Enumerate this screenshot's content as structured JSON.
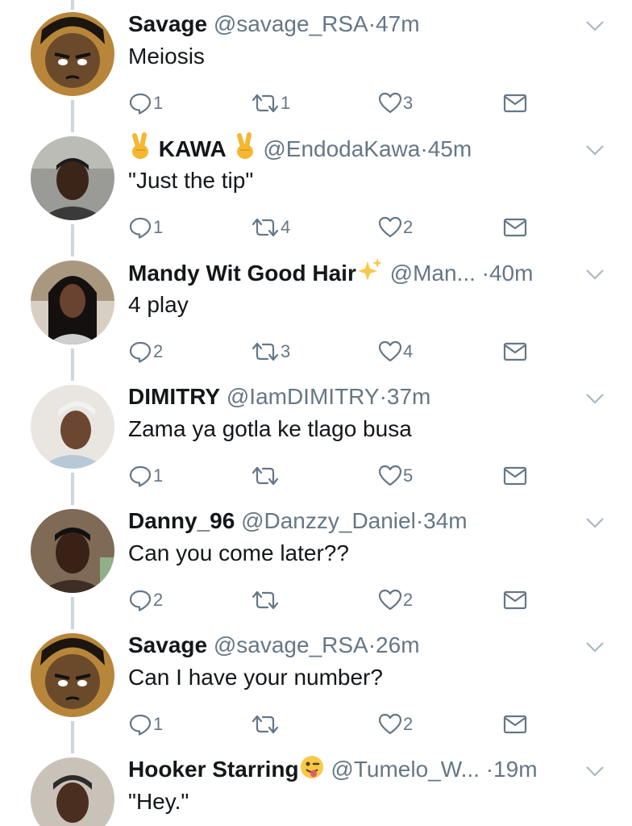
{
  "tweets": [
    {
      "name": "Savage",
      "handle": "@savage_RSA",
      "dot": "·",
      "time": "47m",
      "text": "Meiosis",
      "replies": "1",
      "retweets": "1",
      "likes": "3",
      "avatar": "cartoon-avatar"
    },
    {
      "name_prefix_icon": "victory-hand-emoji",
      "name": "KAWA",
      "name_suffix_icon": "victory-hand-emoji",
      "handle": "@EndodaKawa",
      "dot": "·",
      "time": "45m",
      "text": "\"Just the tip\"",
      "replies": "1",
      "retweets": "4",
      "likes": "2",
      "avatar": "photo-avatar"
    },
    {
      "name": "Mandy Wit Good Hair",
      "name_suffix_icon": "sparkles-emoji",
      "handle": "@Man...",
      "dot": "·",
      "time": "40m",
      "text": "4 play",
      "replies": "2",
      "retweets": "3",
      "likes": "4",
      "avatar": "photo-avatar"
    },
    {
      "name": "DIMITRY",
      "handle": "@IamDIMITRY",
      "dot": "·",
      "time": "37m",
      "text": "Zama ya gotla ke tlago busa",
      "replies": "1",
      "retweets": "",
      "likes": "5",
      "avatar": "photo-avatar"
    },
    {
      "name": "Danny_96",
      "handle": "@Danzzy_Daniel",
      "dot": "·",
      "time": "34m",
      "text": "Can you come later??",
      "replies": "2",
      "retweets": "",
      "likes": "2",
      "avatar": "photo-avatar"
    },
    {
      "name": "Savage",
      "handle": "@savage_RSA",
      "dot": "·",
      "time": "26m",
      "text": "Can I have your number?",
      "replies": "1",
      "retweets": "",
      "likes": "2",
      "avatar": "cartoon-avatar"
    },
    {
      "name": "Hooker Starring",
      "name_suffix_icon": "winking-tongue-emoji",
      "handle": "@Tumelo_W...",
      "dot": "·",
      "time": "19m",
      "text": "\"Hey.\"",
      "avatar": "photo-avatar"
    }
  ],
  "colors": {
    "text": "#14171a",
    "secondary": "#657786",
    "thread_line": "#ccd6dd"
  },
  "icons": [
    "reply-icon",
    "retweet-icon",
    "like-icon",
    "direct-message-icon",
    "chevron-down-icon"
  ]
}
